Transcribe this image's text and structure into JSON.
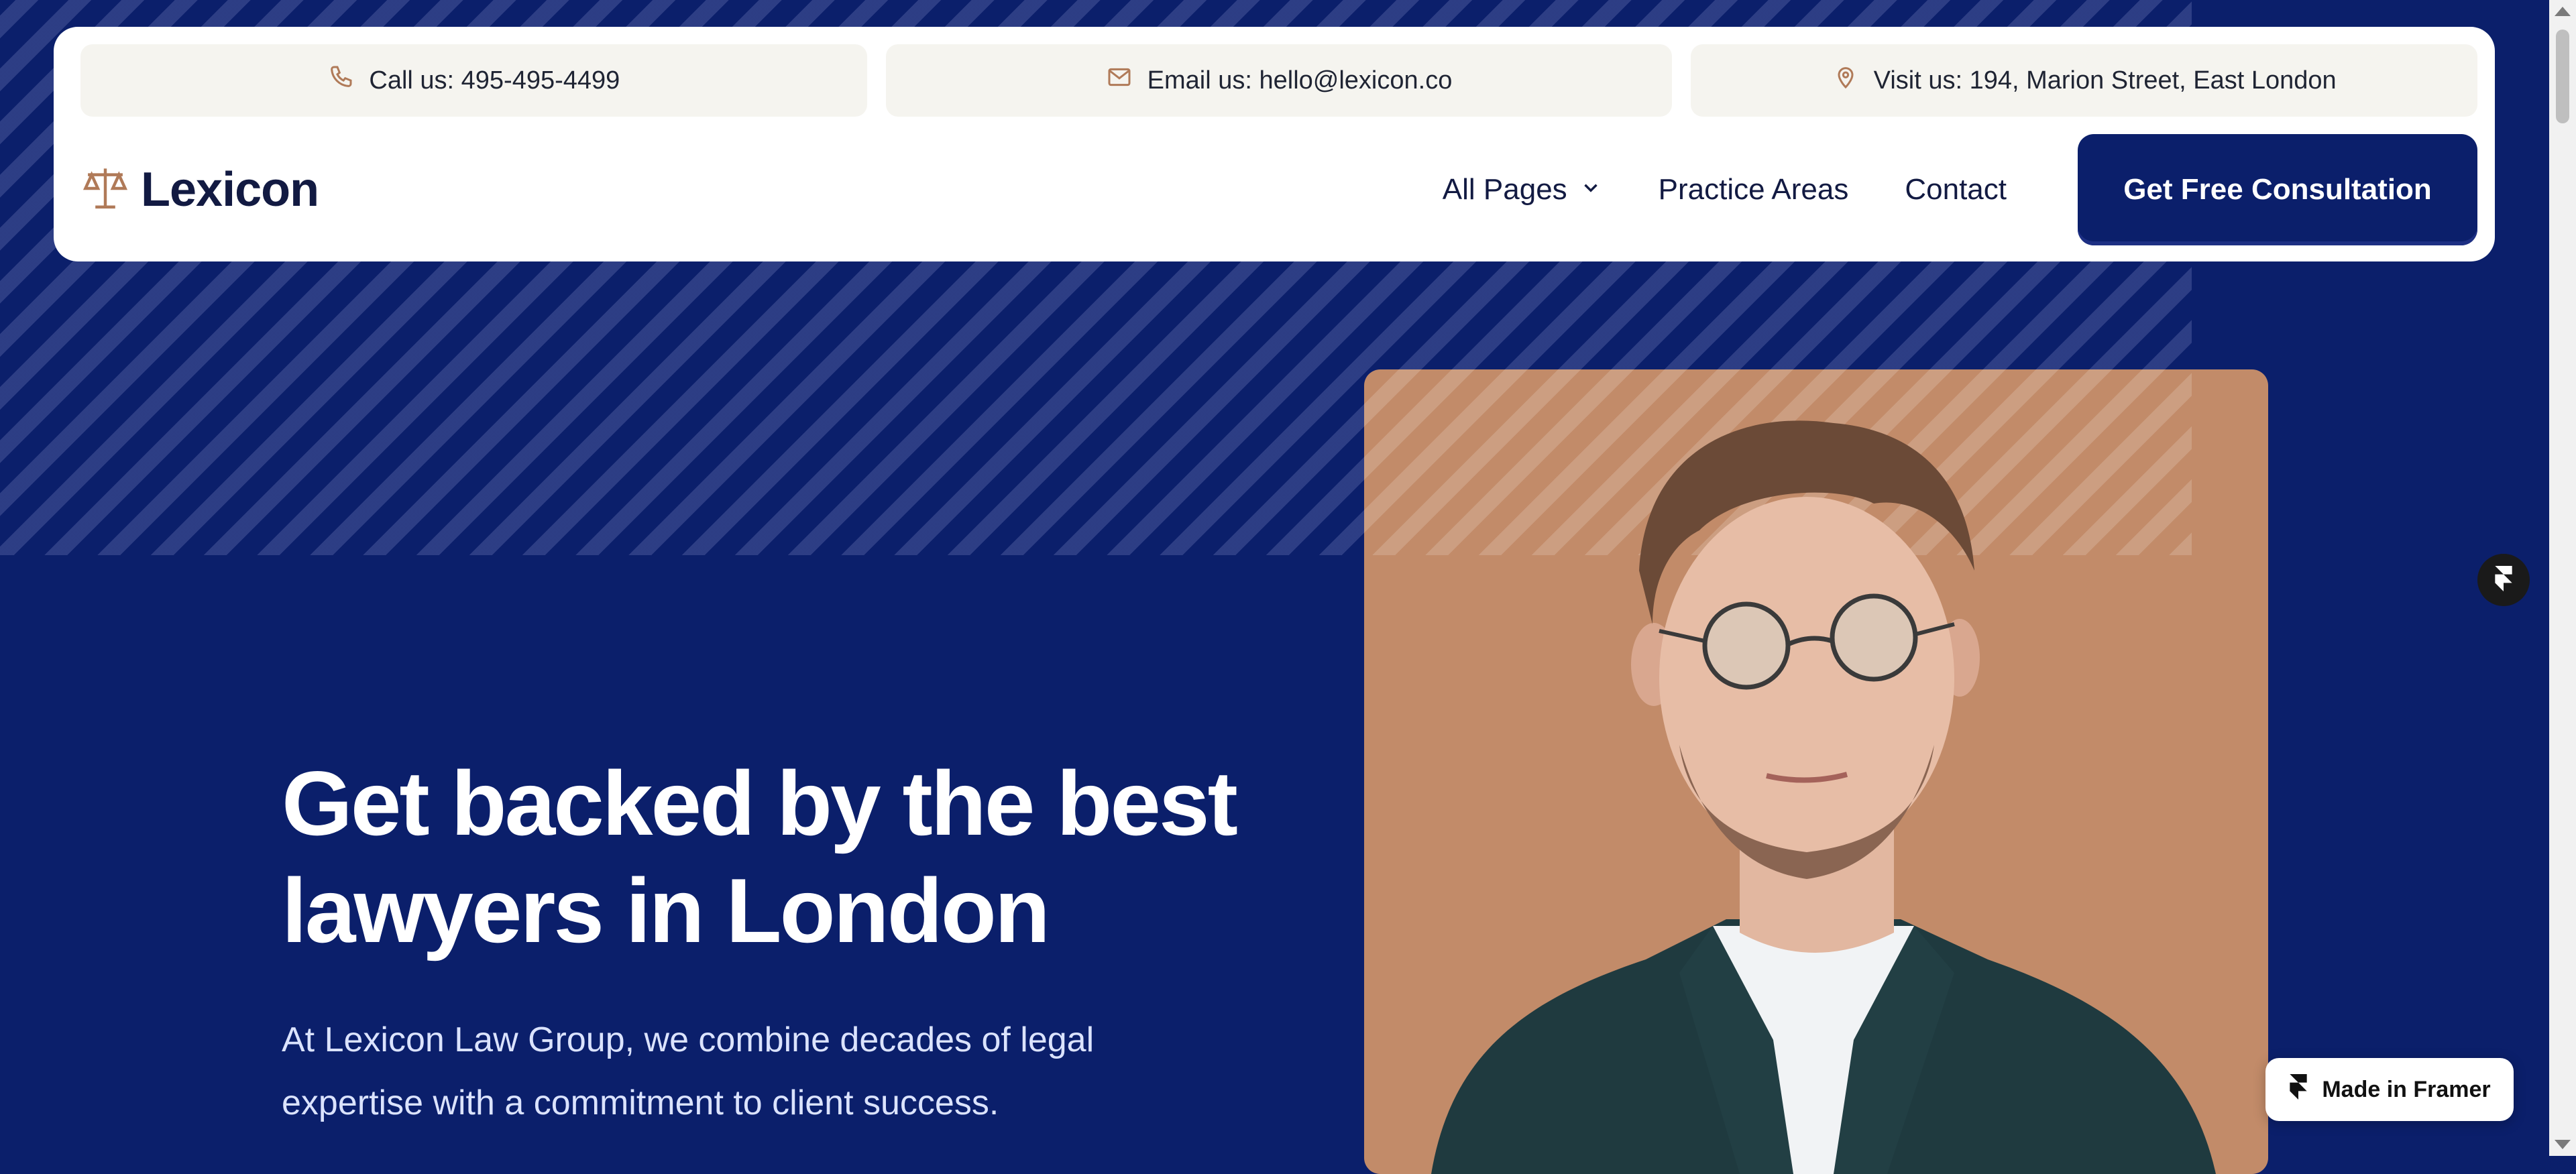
{
  "topbar": {
    "call": "Call us: 495-495-4499",
    "email": "Email us: hello@lexicon.co",
    "visit": "Visit us: 194, Marion Street, East London"
  },
  "brand": {
    "name": "Lexicon",
    "accent": "#b07a58",
    "navy": "#0b1f6b"
  },
  "nav": {
    "items": [
      {
        "label": "All Pages",
        "icon": "chevron-down-icon"
      },
      {
        "label": "Practice Areas"
      },
      {
        "label": "Contact"
      }
    ],
    "cta": "Get Free Consultation"
  },
  "hero": {
    "title_line1": "Get backed by the best",
    "title_line2": "lawyers in London",
    "subtitle_line1": "At Lexicon Law Group, we combine decades of legal",
    "subtitle_line2": "expertise with a commitment to client success."
  },
  "badge": {
    "label": "Made in Framer"
  },
  "icons": [
    "phone-icon",
    "mail-icon",
    "map-pin-icon",
    "scales-logo-icon",
    "framer-icon"
  ]
}
